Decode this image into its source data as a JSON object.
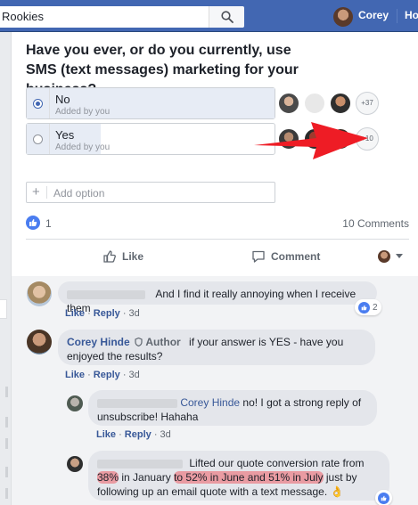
{
  "topbar": {
    "search_text": "Rookies",
    "user_name": "Corey",
    "home_label": "Ho"
  },
  "poll": {
    "question": "Have you ever, or do you currently, use SMS (text messages) marketing for your business?",
    "options": [
      {
        "label": "No",
        "sub": "Added by you",
        "selected": true,
        "more": "+37"
      },
      {
        "label": "Yes",
        "sub": "Added by you",
        "selected": false,
        "more": "+10"
      }
    ],
    "add_option_placeholder": "Add option"
  },
  "engagement": {
    "like_count": "1",
    "comments_label": "10 Comments",
    "like_button": "Like",
    "comment_button": "Comment"
  },
  "comments": [
    {
      "text": "And I find it really annoying when I receive them",
      "like": "Like",
      "reply": "Reply",
      "time": "3d",
      "reactions": "2"
    },
    {
      "author": "Corey Hinde",
      "author_role": "Author",
      "text": "if your answer is YES - have you enjoyed the results?",
      "like": "Like",
      "reply": "Reply",
      "time": "3d",
      "replies": [
        {
          "mention": "Corey Hinde",
          "text": "no! I got a strong reply of unsubscribe! Hahaha",
          "like": "Like",
          "reply": "Reply",
          "time": "3d"
        },
        {
          "text_part1": "Lifted our quote conversion rate from ",
          "text_hl1": "38%",
          "text_part2": "in January ",
          "text_hl2": "to 52% in June and 51% in July",
          "text_part3": " just by following up an email quote with a text message. ",
          "emoji": "👌"
        }
      ]
    }
  ],
  "colors": {
    "facebook_blue": "#4267b2",
    "link": "#385898",
    "arrow_red": "#ee1c25"
  }
}
